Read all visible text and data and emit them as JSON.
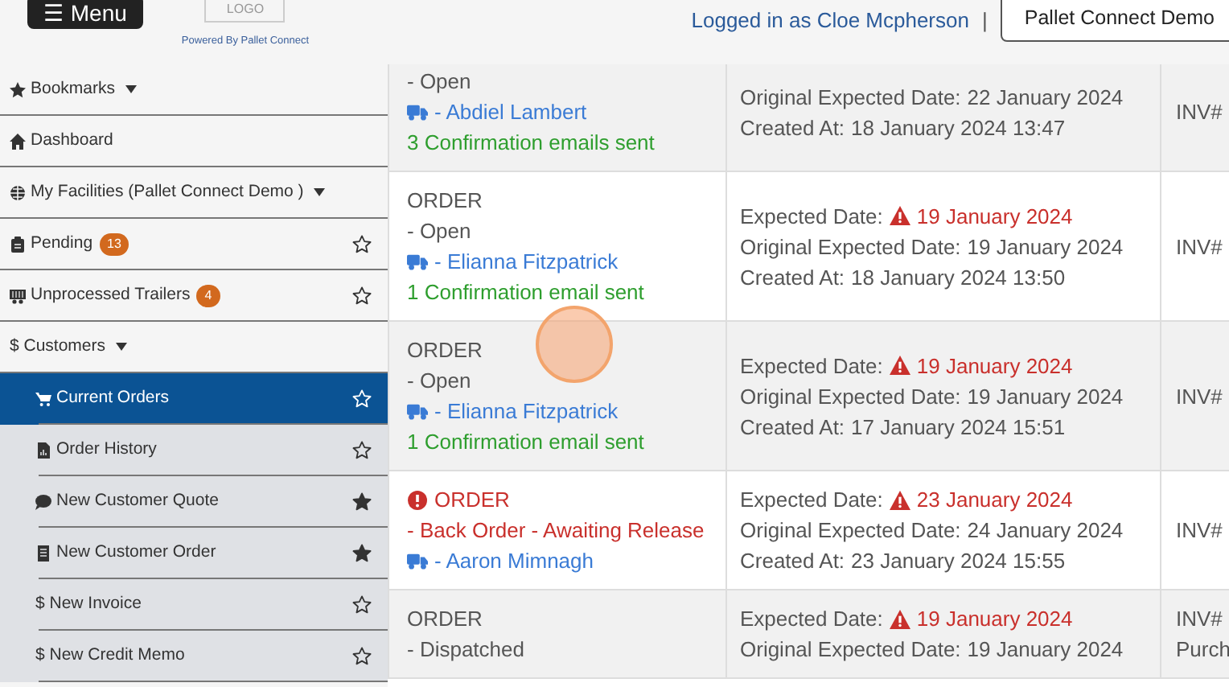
{
  "header": {
    "menu_button": "☰ Menu",
    "logo": "LOGO",
    "powered_by": "Powered By Pallet Connect",
    "logged_in": "Logged in as Cloe Mcpherson",
    "separator": "|",
    "company_button": "Pallet Connect Demo"
  },
  "sidebar": {
    "items": [
      {
        "kind": "dropdown",
        "label": "Bookmarks",
        "selected": false
      },
      {
        "kind": "link",
        "label": "Dashboard",
        "selected": false
      },
      {
        "kind": "dropdown",
        "label": "My Facilities (Pallet Connect Demo )",
        "selected": false
      },
      {
        "kind": "bookmarkable",
        "label": "Pending",
        "badge": "13",
        "starred": false,
        "selected": false
      },
      {
        "kind": "bookmarkable",
        "label": "Unprocessed Trailers",
        "badge": "4",
        "starred": false,
        "selected": false
      },
      {
        "kind": "dropdown",
        "label": "$ Customers",
        "selected": false
      },
      {
        "kind": "subitem",
        "label": "Current Orders",
        "starred": false,
        "selected": true
      },
      {
        "kind": "subitem",
        "label": "Order History",
        "starred": false,
        "selected": false
      },
      {
        "kind": "subitem",
        "label": "New Customer Quote",
        "starred": true,
        "selected": false
      },
      {
        "kind": "subitem",
        "label": "New Customer Order",
        "starred": true,
        "selected": false
      },
      {
        "kind": "subitem",
        "label": "$ New Invoice",
        "starred": false,
        "selected": false
      },
      {
        "kind": "subitem",
        "label": "$ New Credit Memo",
        "starred": false,
        "selected": false
      }
    ]
  },
  "orders": [
    {
      "info": [
        {
          "kind": "status",
          "text": "- Open"
        },
        {
          "kind": "driver",
          "text": "- Abdiel Lambert"
        },
        {
          "kind": "emails",
          "text": "3 Confirmation emails sent"
        }
      ],
      "dates": [
        {
          "label": "Original Expected Date:",
          "value": "22 January 2024",
          "warning": false
        },
        {
          "label": "Created At:",
          "value": "18 January 2024 13:47",
          "warning": false
        }
      ],
      "refs": [
        "INV#"
      ]
    },
    {
      "info": [
        {
          "kind": "type",
          "text": "ORDER"
        },
        {
          "kind": "status",
          "text": "- Open"
        },
        {
          "kind": "driver",
          "text": "- Elianna Fitzpatrick"
        },
        {
          "kind": "emails",
          "text": "1 Confirmation email sent"
        }
      ],
      "dates": [
        {
          "label": "Expected Date:",
          "value": "19 January 2024",
          "warning": true
        },
        {
          "label": "Original Expected Date:",
          "value": "19 January 2024",
          "warning": false
        },
        {
          "label": "Created At:",
          "value": "18 January 2024 13:50",
          "warning": false
        }
      ],
      "refs": [
        "INV#"
      ]
    },
    {
      "info": [
        {
          "kind": "type",
          "text": "ORDER"
        },
        {
          "kind": "status",
          "text": "- Open"
        },
        {
          "kind": "driver",
          "text": "- Elianna Fitzpatrick"
        },
        {
          "kind": "emails",
          "text": "1 Confirmation email sent"
        }
      ],
      "dates": [
        {
          "label": "Expected Date:",
          "value": "19 January 2024",
          "warning": true
        },
        {
          "label": "Original Expected Date:",
          "value": "19 January 2024",
          "warning": false
        },
        {
          "label": "Created At:",
          "value": "17 January 2024 15:51",
          "warning": false
        }
      ],
      "refs": [
        "INV#"
      ]
    },
    {
      "alert": true,
      "info": [
        {
          "kind": "type",
          "text": "ORDER"
        },
        {
          "kind": "status",
          "text": "- Back Order - Awaiting Release"
        },
        {
          "kind": "driver",
          "text": "- Aaron Mimnagh"
        }
      ],
      "dates": [
        {
          "label": "Expected Date:",
          "value": "23 January 2024",
          "warning": true
        },
        {
          "label": "Original Expected Date:",
          "value": "24 January 2024",
          "warning": false
        },
        {
          "label": "Created At:",
          "value": "23 January 2024 15:55",
          "warning": false
        }
      ],
      "refs": [
        "INV#"
      ]
    },
    {
      "info": [
        {
          "kind": "type",
          "text": "ORDER"
        },
        {
          "kind": "status",
          "text": "- Dispatched"
        }
      ],
      "dates": [
        {
          "label": "Expected Date:",
          "value": "19 January 2024",
          "warning": true
        },
        {
          "label": "Original Expected Date:",
          "value": "19 January 2024",
          "warning": false
        }
      ],
      "refs": [
        "INV#",
        "Purch"
      ]
    }
  ]
}
